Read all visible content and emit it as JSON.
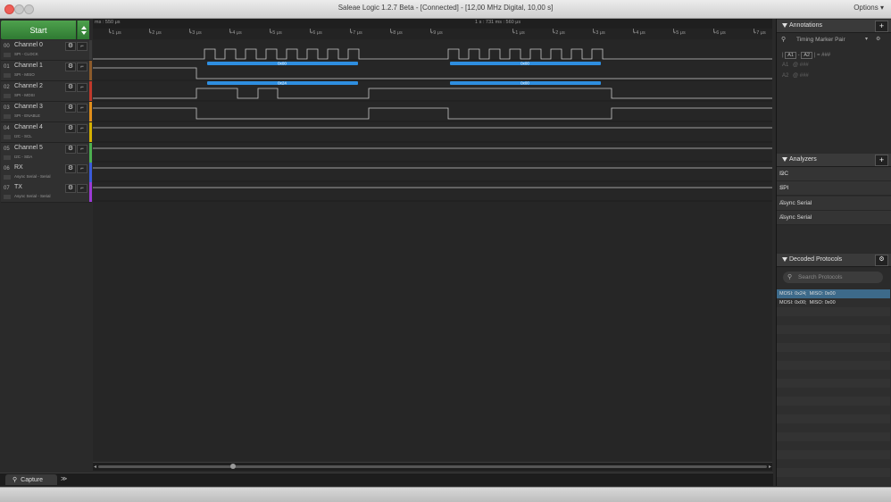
{
  "window": {
    "title": "Saleae Logic 1.2.7 Beta - [Connected] - [12,00 MHz Digital, 10,00 s]",
    "options_label": "Options ▾"
  },
  "capture": {
    "start_label": "Start"
  },
  "channels": [
    {
      "num": "00",
      "name": "Channel 0",
      "sub": "SPI - CLOCK",
      "color": "#3a3a3a"
    },
    {
      "num": "01",
      "name": "Channel 1",
      "sub": "SPI - MISO",
      "color": "#8b5a2b"
    },
    {
      "num": "02",
      "name": "Channel 2",
      "sub": "SPI - MOSI",
      "color": "#c0392b"
    },
    {
      "num": "03",
      "name": "Channel 3",
      "sub": "SPI - ENABLE",
      "color": "#e08e1b"
    },
    {
      "num": "04",
      "name": "Channel 4",
      "sub": "I2C - SCL",
      "color": "#d4b000"
    },
    {
      "num": "05",
      "name": "Channel 5",
      "sub": "I2C - SDA",
      "color": "#4caf50"
    },
    {
      "num": "06",
      "name": "RX",
      "sub": "Async Serial - Serial",
      "color": "#3b5bdb"
    },
    {
      "num": "07",
      "name": "TX",
      "sub": "Async Serial - Serial",
      "color": "#9c3bd6"
    }
  ],
  "timeline": {
    "left_label": "ms : 550 μs",
    "center_label": "1 s : 731 ms : 560 μs",
    "ticks": [
      "+1 μs",
      "+2 μs",
      "+3 μs",
      "+4 μs",
      "+5 μs",
      "+6 μs",
      "+7 μs",
      "+8 μs",
      "+9 μs",
      "+1 μs",
      "+2 μs",
      "+3 μs",
      "+4 μs",
      "+5 μs",
      "+6 μs",
      "+7 μs"
    ]
  },
  "decoded_bars": [
    {
      "lane": "miso",
      "label": "0x00"
    },
    {
      "lane": "miso",
      "label": "0x00"
    },
    {
      "lane": "mosi",
      "label": "0x24"
    },
    {
      "lane": "mosi",
      "label": "0x00"
    }
  ],
  "bottom_tabs": {
    "capture_label": "Capture",
    "more_label": "≫"
  },
  "annotations": {
    "title": "Annotations",
    "add_label": "+",
    "marker_label": "Timing Marker Pair",
    "a1a2_text": "= ###",
    "a1_label": "A1",
    "a2_label": "A2",
    "a1_value": "@  ###",
    "a2_value": "@  ###",
    "minus_label": "-"
  },
  "analyzers": {
    "title": "Analyzers",
    "add_label": "+",
    "items": [
      "I2C",
      "SPI",
      "Async Serial",
      "Async Serial"
    ]
  },
  "decoded_protocols": {
    "title": "Decoded Protocols",
    "search_placeholder": "Search Protocols",
    "rows": [
      "MOSI: 0x24;  MISO: 0x00",
      "MOSI: 0x00;  MISO: 0x00"
    ],
    "selected_color": "#3d6a8a"
  },
  "colors": {
    "protocol_bar": "#2e8ee0",
    "start_green": "#3f8f40"
  }
}
